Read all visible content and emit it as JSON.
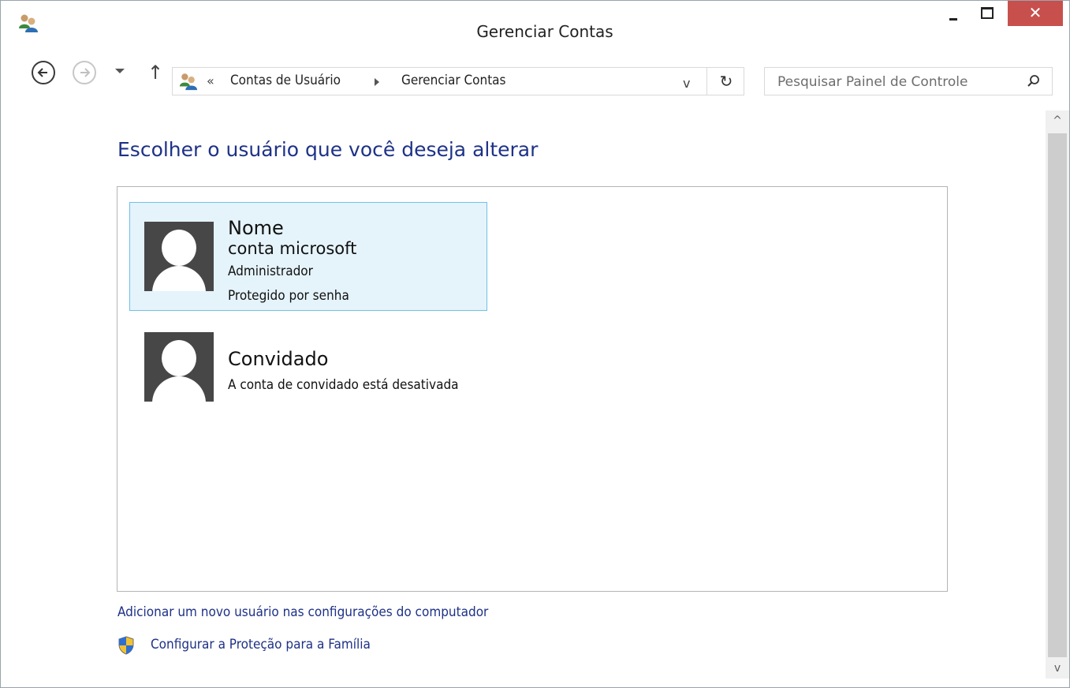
{
  "window": {
    "title": "Gerenciar Contas",
    "close_glyph": "✕"
  },
  "nav": {
    "up_glyph": "↑",
    "address": {
      "chevron": "«",
      "crumbs": [
        "Contas de Usuário",
        "Gerenciar Contas"
      ],
      "dropdown_glyph": "v",
      "refresh_glyph": "↻"
    },
    "search": {
      "placeholder": "Pesquisar Painel de Controle"
    }
  },
  "main": {
    "heading": "Escolher o usuário que você deseja alterar",
    "accounts": [
      {
        "name": "Nome",
        "type": "conta microsoft",
        "lines": [
          "Administrador",
          "Protegido por senha"
        ],
        "selected": true
      },
      {
        "name": "Convidado",
        "lines": [
          "A conta de convidado está desativada"
        ],
        "selected": false
      }
    ],
    "links": {
      "add_user": "Adicionar um novo usuário nas configurações do computador",
      "family": "Configurar a Proteção para a Família"
    }
  },
  "scrollbar": {
    "up_glyph": "^",
    "down_glyph": "v"
  },
  "colors": {
    "heading": "#1e3287",
    "selection_bg": "#e5f3fb",
    "selection_border": "#70c0e7",
    "close_button": "#c7504d"
  }
}
